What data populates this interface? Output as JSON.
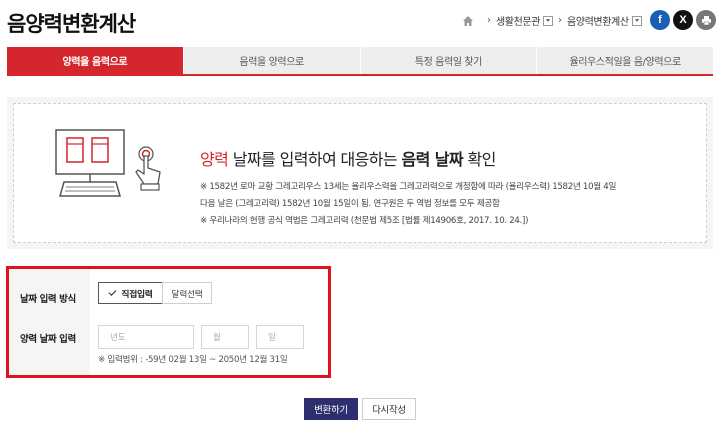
{
  "header": {
    "title": "음양력변환계산",
    "breadcrumb": [
      {
        "label": "생활천문관"
      },
      {
        "label": "음양력변환계산"
      }
    ],
    "social": {
      "facebook": "f",
      "x": "X"
    }
  },
  "tabs": [
    {
      "label": "양력을 음력으로",
      "active": true
    },
    {
      "label": "음력을 양력으로",
      "active": false
    },
    {
      "label": "특정 음력일 찾기",
      "active": false
    },
    {
      "label": "율리우스적일을 음/양력으로",
      "active": false
    }
  ],
  "info": {
    "heading_red": "양력",
    "heading_mid1": " 날짜를 입력하여 대응하는 ",
    "heading_bold1": "음력 날짜",
    "heading_end": " 확인",
    "notes": [
      "※ 1582년 로마 교황 그레고리우스 13세는 율리우스력을 그레고리력으로 개정함에 따라 (율리우스력) 1582년 10월 4일",
      "다음 날은 (그레고리력) 1582년 10월 15일이 됨. 연구원은 두 역법 정보를 모두 제공함",
      "※ 우리나라의 현행 공식 역법은 그레고리력 (천문법 제5조 [법률 제14906호, 2017. 10. 24.])"
    ]
  },
  "form": {
    "method_label": "날짜 입력 방식",
    "method_direct": "직접입력",
    "method_calendar": "달력선택",
    "date_label": "양력 날짜 입력",
    "year_placeholder": "년도",
    "month_placeholder": "월",
    "day_placeholder": "일",
    "range_note": "※ 입력범위 : -59년 02월 13일 ~ 2050년 12월 31일"
  },
  "actions": {
    "convert": "변환하기",
    "reset": "다시작성"
  },
  "colors": {
    "accent_red": "#d6262d",
    "button_navy": "#2d2f6e",
    "highlight_frame": "#e0121e"
  }
}
